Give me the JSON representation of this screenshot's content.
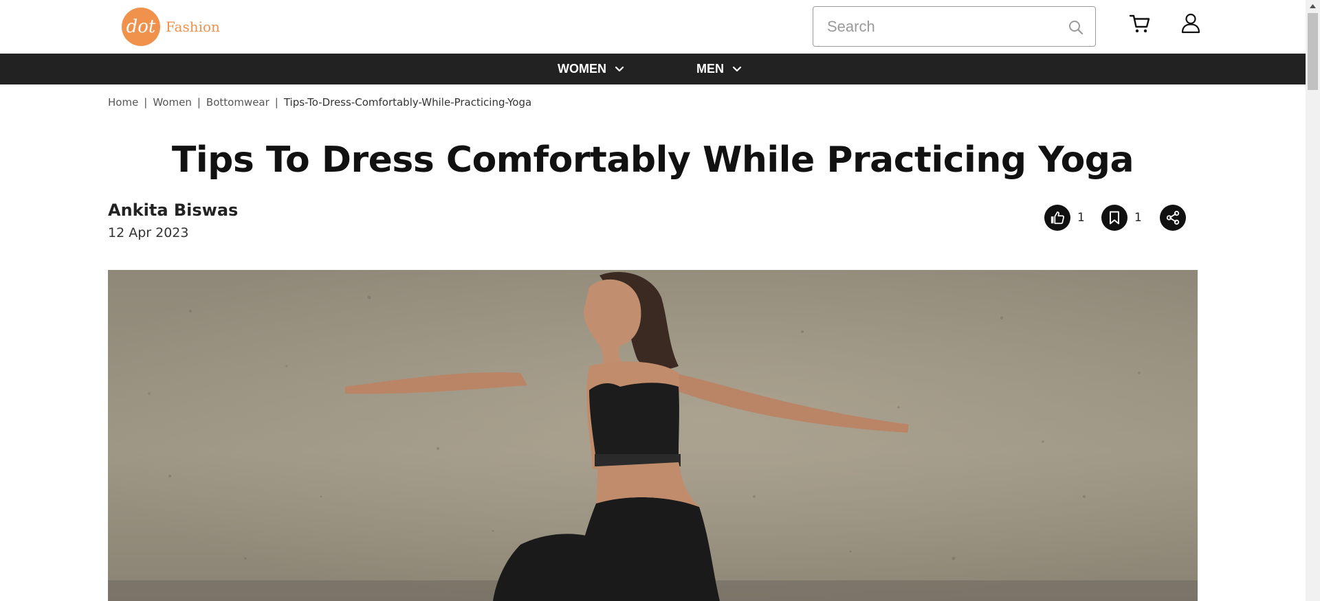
{
  "brand": {
    "logo_mark": "dot",
    "name": "Fashion",
    "accent_color": "#f0924c"
  },
  "search": {
    "placeholder": "Search",
    "value": ""
  },
  "header_icons": [
    "search-icon",
    "cart-icon",
    "user-icon"
  ],
  "nav": {
    "items": [
      {
        "label": "WOMEN"
      },
      {
        "label": "MEN"
      }
    ]
  },
  "breadcrumb": {
    "items": [
      "Home",
      "Women",
      "Bottomwear"
    ],
    "current": "Tips-To-Dress-Comfortably-While-Practicing-Yoga"
  },
  "article": {
    "title": "Tips To Dress Comfortably While Practicing Yoga",
    "author": "Ankita Biswas",
    "date": "12 Apr 2023",
    "likes": "1",
    "saves": "1",
    "hero_image": "woman-in-black-sportswear-doing-yoga-warrior-pose-against-concrete-wall"
  }
}
